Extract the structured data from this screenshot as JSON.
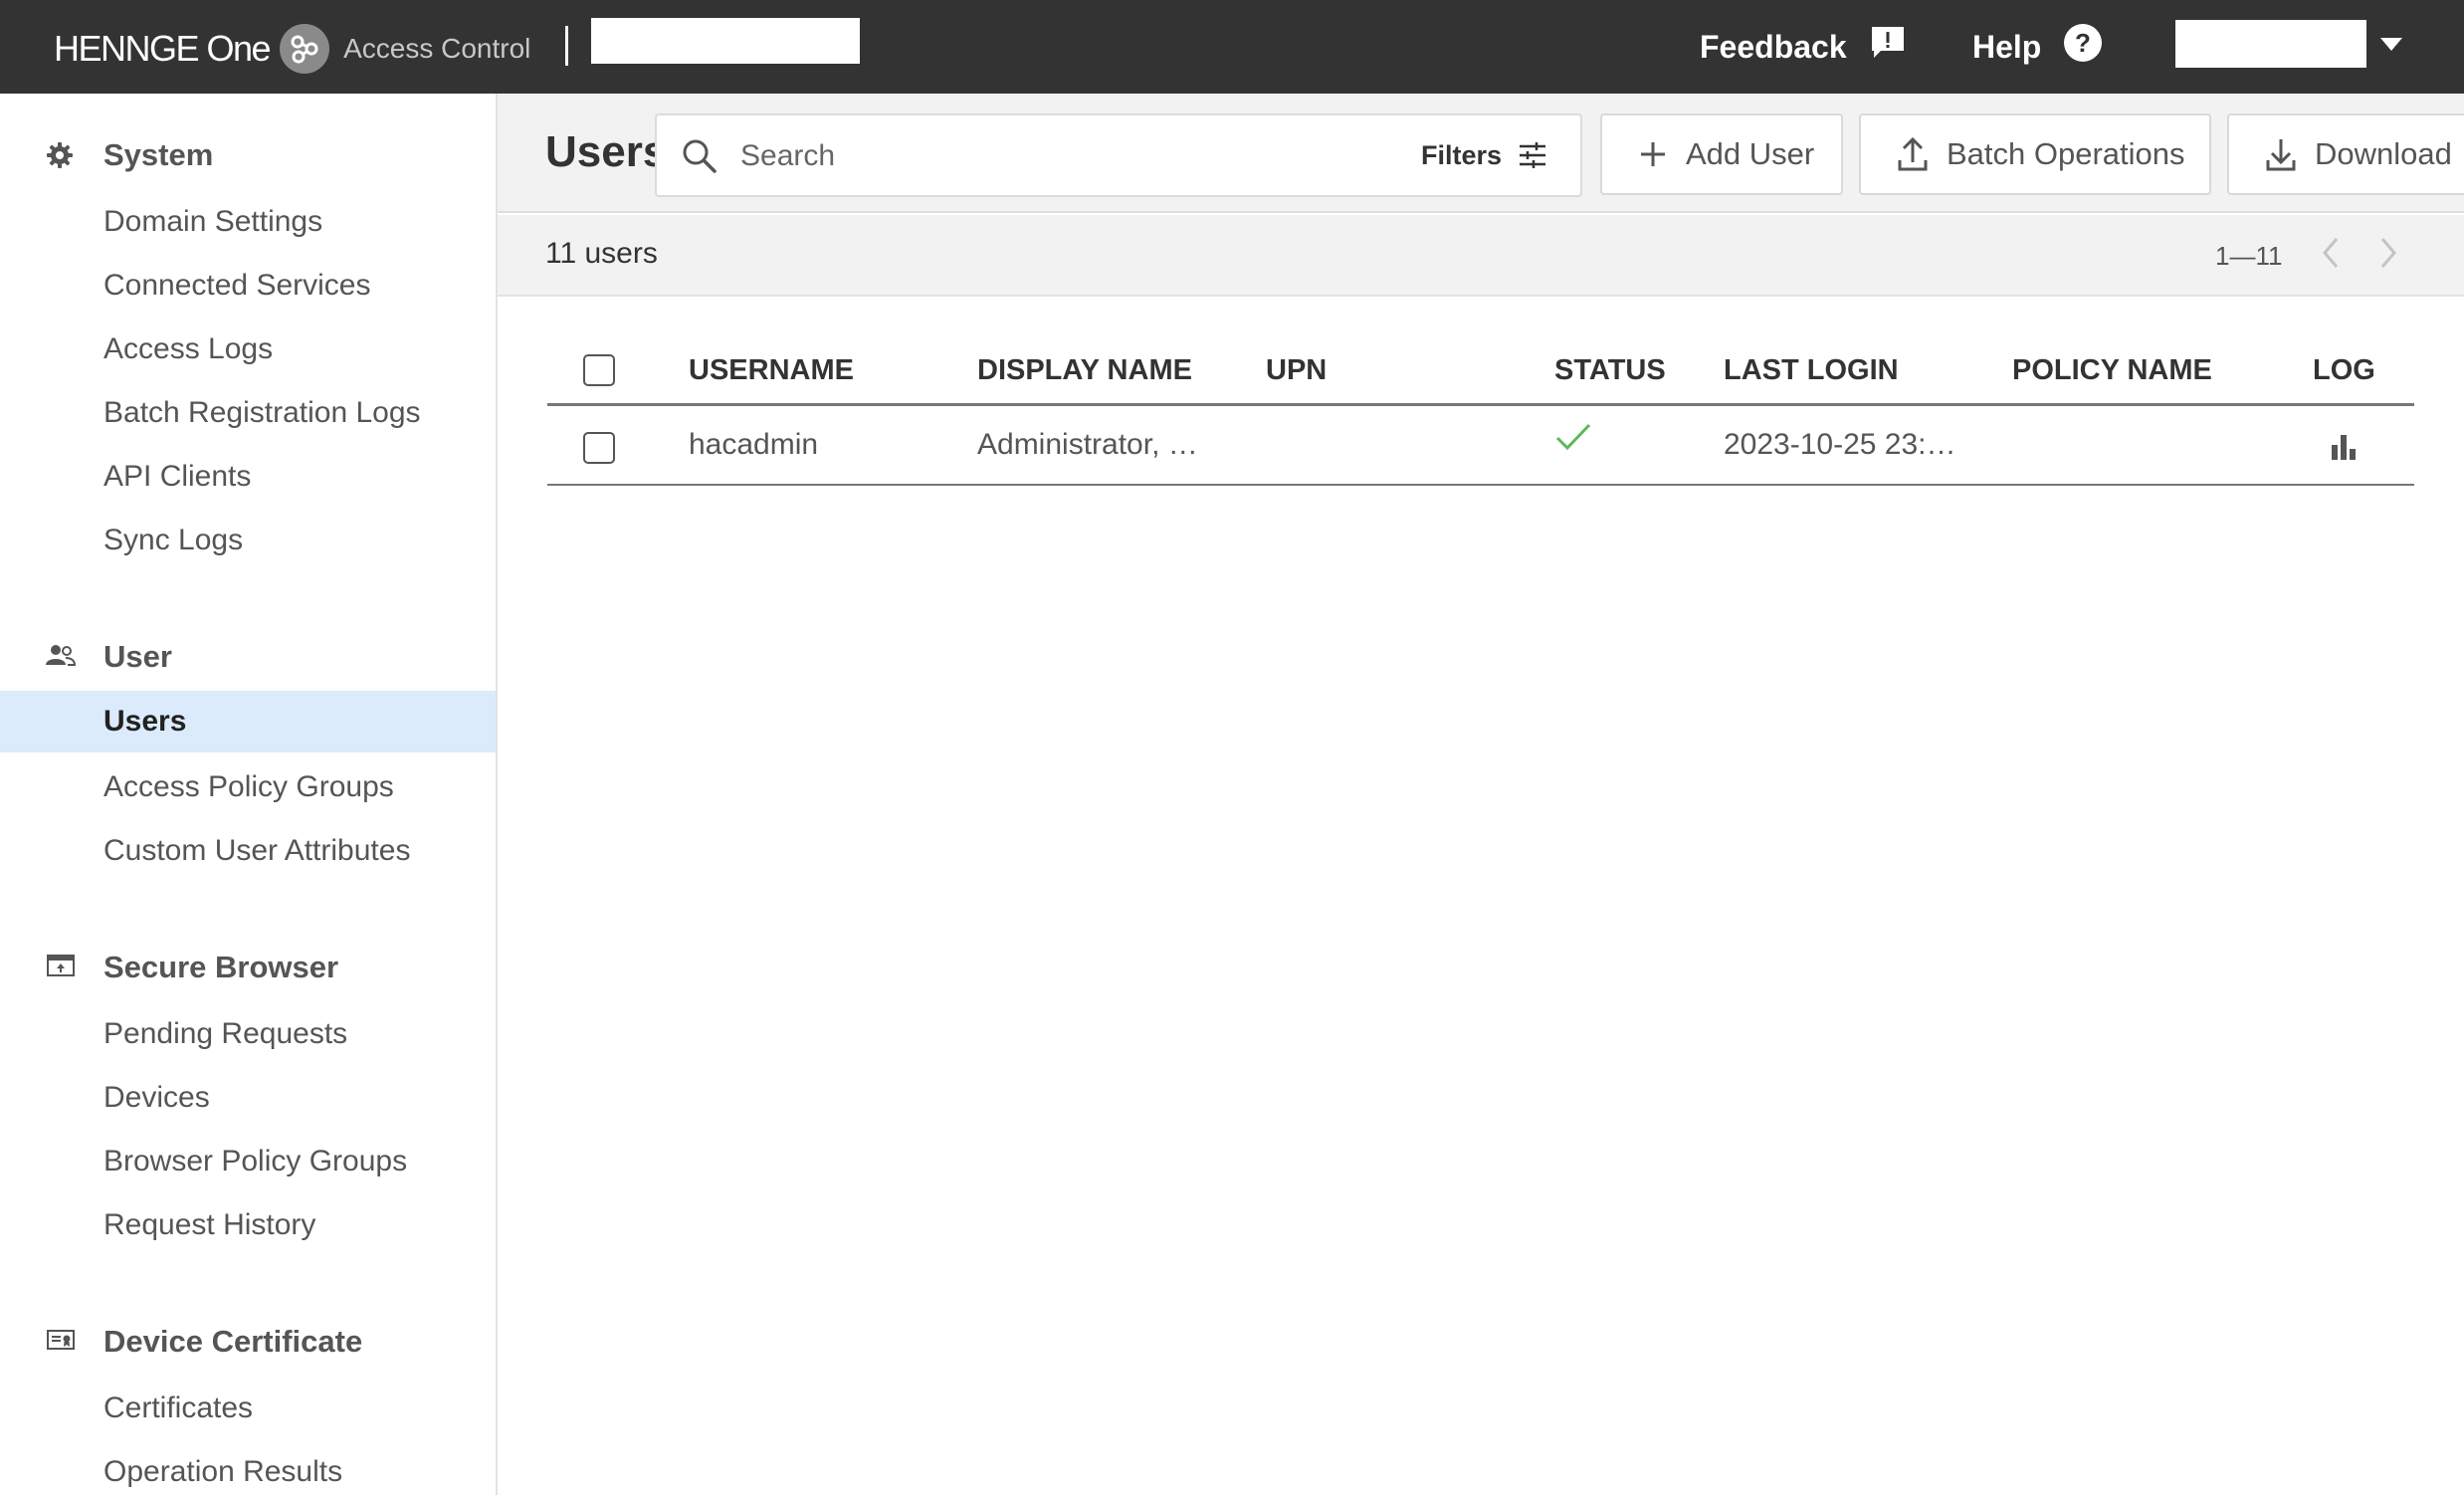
{
  "header": {
    "brand": "HENNGE One",
    "product": "Access Control",
    "feedback_label": "Feedback",
    "help_label": "Help"
  },
  "sidebar": {
    "sections": [
      {
        "label": "System",
        "icon": "gear-icon",
        "items": [
          "Domain Settings",
          "Connected Services",
          "Access Logs",
          "Batch Registration Logs",
          "API Clients",
          "Sync Logs"
        ]
      },
      {
        "label": "User",
        "icon": "people-icon",
        "items": [
          "Users",
          "Access Policy Groups",
          "Custom User Attributes"
        ]
      },
      {
        "label": "Secure Browser",
        "icon": "browser-icon",
        "items": [
          "Pending Requests",
          "Devices",
          "Browser Policy Groups",
          "Request History"
        ]
      },
      {
        "label": "Device Certificate",
        "icon": "certificate-icon",
        "items": [
          "Certificates",
          "Operation Results"
        ]
      }
    ],
    "active_item": "Users"
  },
  "toolbar": {
    "title": "Users",
    "search_placeholder": "Search",
    "filters_label": "Filters",
    "add_user_label": "Add User",
    "batch_operations_label": "Batch Operations",
    "download_label": "Download"
  },
  "summary": {
    "count_text": "11 users",
    "range_text": "1—11"
  },
  "table": {
    "columns": [
      "USERNAME",
      "DISPLAY NAME",
      "UPN",
      "STATUS",
      "LAST LOGIN",
      "POLICY NAME",
      "LOG"
    ],
    "rows": [
      {
        "username": "hacadmin",
        "display_name": "Administrator, …",
        "upn": "",
        "status": "active",
        "last_login": "2023-10-25 23:…",
        "policy_name": ""
      }
    ]
  },
  "colors": {
    "header_bg": "#333333",
    "active_nav_bg": "#dcebfb",
    "status_ok": "#5cb85c"
  }
}
